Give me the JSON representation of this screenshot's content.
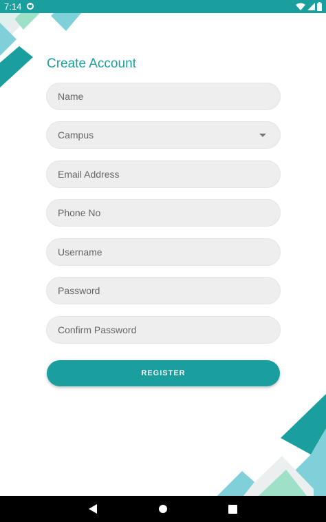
{
  "status_bar": {
    "time": "7:14",
    "color": "#1a9e9e",
    "icons": [
      "sync-icon",
      "wifi-icon",
      "signal-icon",
      "battery-icon"
    ]
  },
  "form": {
    "title": "Create Account",
    "fields": {
      "name": {
        "placeholder": "Name",
        "value": ""
      },
      "campus": {
        "label": "Campus"
      },
      "email": {
        "placeholder": "Email Address",
        "value": ""
      },
      "phone": {
        "placeholder": "Phone No",
        "value": ""
      },
      "username": {
        "placeholder": "Username",
        "value": ""
      },
      "password": {
        "placeholder": "Password",
        "value": ""
      },
      "confirm_password": {
        "placeholder": "Confirm Password",
        "value": ""
      }
    },
    "register_label": "REGISTER"
  },
  "theme": {
    "accent": "#1a9e9e",
    "accent_light": "#7fd0d8",
    "accent_mint": "#9ee0c8",
    "field_bg": "#eeeeee"
  },
  "nav_bar": {
    "icons": [
      "back-icon",
      "home-icon",
      "recents-icon"
    ]
  }
}
